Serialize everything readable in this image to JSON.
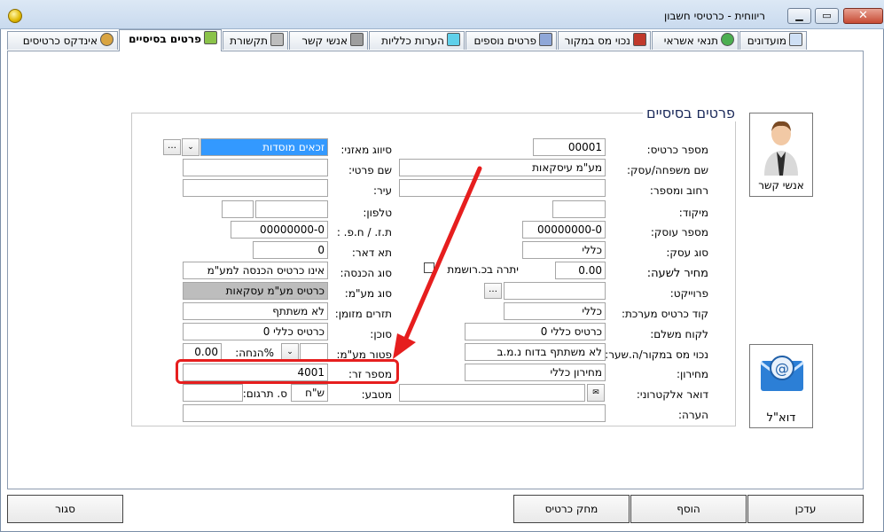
{
  "window": {
    "title": "ריווחית - כרטיסי חשבון",
    "controls": {
      "minimize": "▁",
      "maximize": "▭",
      "close": "✕"
    }
  },
  "tabs": [
    {
      "label": "מועדונים",
      "icon": "calendar-icon"
    },
    {
      "label": "תנאי אשראי",
      "icon": "money-bag-icon"
    },
    {
      "label": "נכוי מס במקור",
      "icon": "tools-icon"
    },
    {
      "label": "פרטים נוספים",
      "icon": "document-icon"
    },
    {
      "label": "הערות כלליות",
      "icon": "edit-icon"
    },
    {
      "label": "אנשי קשר",
      "icon": "people-icon"
    },
    {
      "label": "תקשורת",
      "icon": "phone-icon"
    },
    {
      "label": "פרטים בסיסיים",
      "icon": "book-icon",
      "active": true
    },
    {
      "label": "אינדקס כרטיסים",
      "icon": "index-icon"
    }
  ],
  "section": {
    "title": "פרטים בסיסיים"
  },
  "right_col": {
    "card_number": {
      "label": "מספר כרטיס:",
      "value": "00001"
    },
    "family_name": {
      "label": "שם משפחה/עסק:",
      "value": "מע\"מ עיסקאות"
    },
    "street": {
      "label": "רחוב ומספר:",
      "value": ""
    },
    "zip": {
      "label": "מיקוד:",
      "value": ""
    },
    "business_no": {
      "label": "מספר עוסק:",
      "value": "00000000-0"
    },
    "business_type": {
      "label": "סוג עסק:",
      "value": "כללי"
    },
    "hourly_price": {
      "label": "מחיר לשעה:",
      "value": "0.00"
    },
    "project": {
      "label": "פרוייקט:",
      "value": ""
    },
    "system_code": {
      "label": "קוד כרטיס מערכת:",
      "value": "כללי"
    },
    "paying_customer": {
      "label": "לקוח משלם:",
      "value": "כרטיס כללי 0"
    },
    "withholding": {
      "label": "נכוי מס במקור/ה.שער:",
      "value": "לא משתתף בדוח נ.מ.ב"
    },
    "price_list": {
      "label": "מחירון:",
      "value": "מחירון כללי"
    },
    "email": {
      "label": "דואר אלקטרוני:",
      "value": ""
    },
    "note": {
      "label": "הערה:",
      "value": ""
    },
    "balance_check": {
      "label": "יתרה בכ.רושמת"
    }
  },
  "left_col": {
    "balance_class": {
      "label": "סיווג מאזני:",
      "value": "זכאים מוסדות"
    },
    "first_name": {
      "label": "שם פרטי:",
      "value": ""
    },
    "city": {
      "label": "עיר:",
      "value": ""
    },
    "phone": {
      "label": "טלפון:",
      "value": ""
    },
    "id_no": {
      "label": "ת.ז. / ח.פ. :",
      "value": "00000000-0"
    },
    "po_box": {
      "label": "תא דאר:",
      "value": "0"
    },
    "income_type": {
      "label": "סוג הכנסה:",
      "value": "אינו כרטיס הכנסה למע\"מ"
    },
    "vat_type": {
      "label": "סוג מע\"מ:",
      "value": "כרטיס מע\"מ עסקאות"
    },
    "cash_flow": {
      "label": "תזרים מזומן:",
      "value": "לא משתתף"
    },
    "agent": {
      "label": "סוכן:",
      "value": "כרטיס כללי 0"
    },
    "vat_exempt": {
      "label": "פטור מע\"מ:",
      "value": ""
    },
    "discount": {
      "label": "%הנחה:",
      "value": "0.00"
    },
    "foreign_no": {
      "label": "מספר זר:",
      "value": "4001"
    },
    "currency": {
      "label": "מטבע:",
      "value": "ש\"ח"
    },
    "translation": {
      "label": "ס. תרגום:",
      "value": ""
    }
  },
  "side_buttons": {
    "contacts": "אנשי קשר",
    "email": "דוא\"ל"
  },
  "footer": {
    "update": "עדכן",
    "add": "הוסף",
    "delete": "מחק כרטיס",
    "close": "סגור"
  },
  "colors": {
    "highlight": "#e61e1e",
    "selection": "#3399ff"
  }
}
